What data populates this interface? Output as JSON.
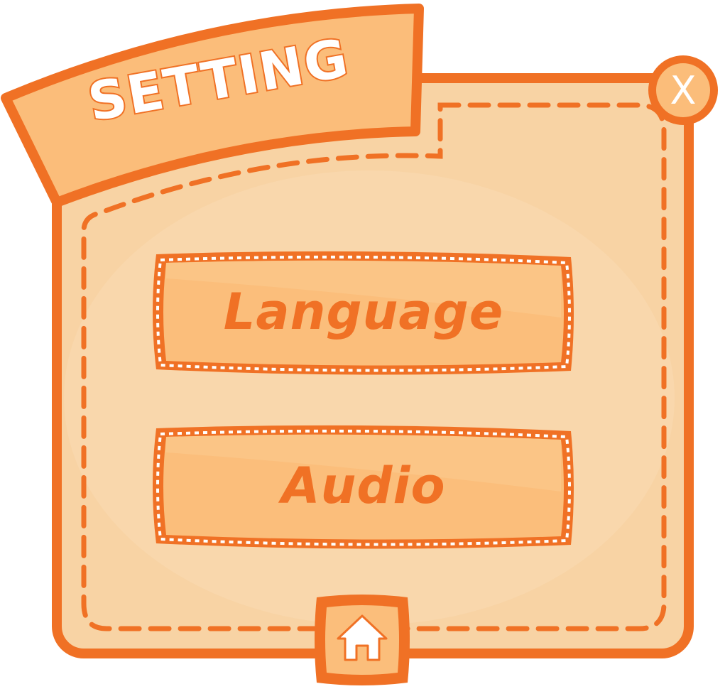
{
  "dialog": {
    "title": "SETTING",
    "close_label": "X"
  },
  "menu": {
    "items": [
      {
        "label": "Language"
      },
      {
        "label": "Audio"
      }
    ]
  },
  "icons": {
    "close": "close-icon",
    "home": "home-icon"
  },
  "colors": {
    "accent": "#f07125",
    "panel_fill": "#f8d2a3",
    "panel_inner": "#f5cb98",
    "banner_fill": "#fbbd7a",
    "button_fill": "#fbbe7b",
    "white": "#ffffff"
  }
}
